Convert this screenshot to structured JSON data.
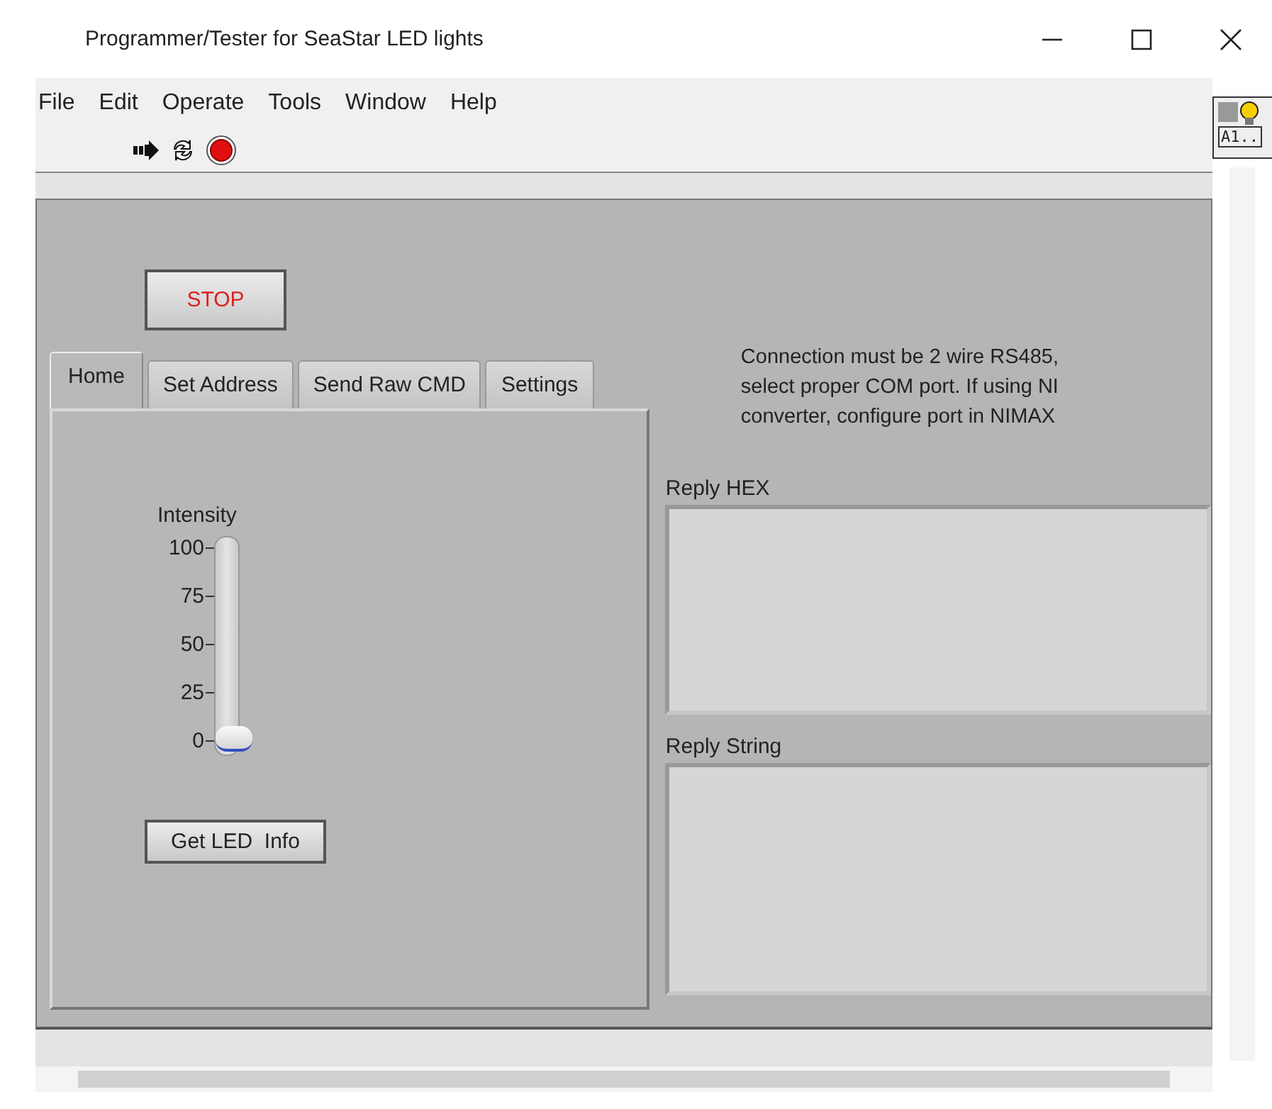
{
  "window": {
    "title": "Programmer/Tester for SeaStar LED lights"
  },
  "menu": [
    "File",
    "Edit",
    "Operate",
    "Tools",
    "Window",
    "Help"
  ],
  "connector_pane": {
    "label": "A1.."
  },
  "stop_button": {
    "label": "STOP"
  },
  "tabs": [
    {
      "label": "Home",
      "selected": true
    },
    {
      "label": "Set Address",
      "selected": false
    },
    {
      "label": "Send Raw CMD",
      "selected": false
    },
    {
      "label": "Settings",
      "selected": false
    }
  ],
  "intensity": {
    "label": "Intensity",
    "ticks": [
      "100",
      "75",
      "50",
      "25",
      "0"
    ],
    "level": 0
  },
  "get_info_button": {
    "label": "Get LED  Info"
  },
  "note": "Connection must be 2 wire RS485,\nselect proper COM port. If using NI\nconverter, configure port in NIMAX",
  "reply_hex": {
    "label": "Reply HEX"
  },
  "reply_string": {
    "label": "Reply String"
  }
}
